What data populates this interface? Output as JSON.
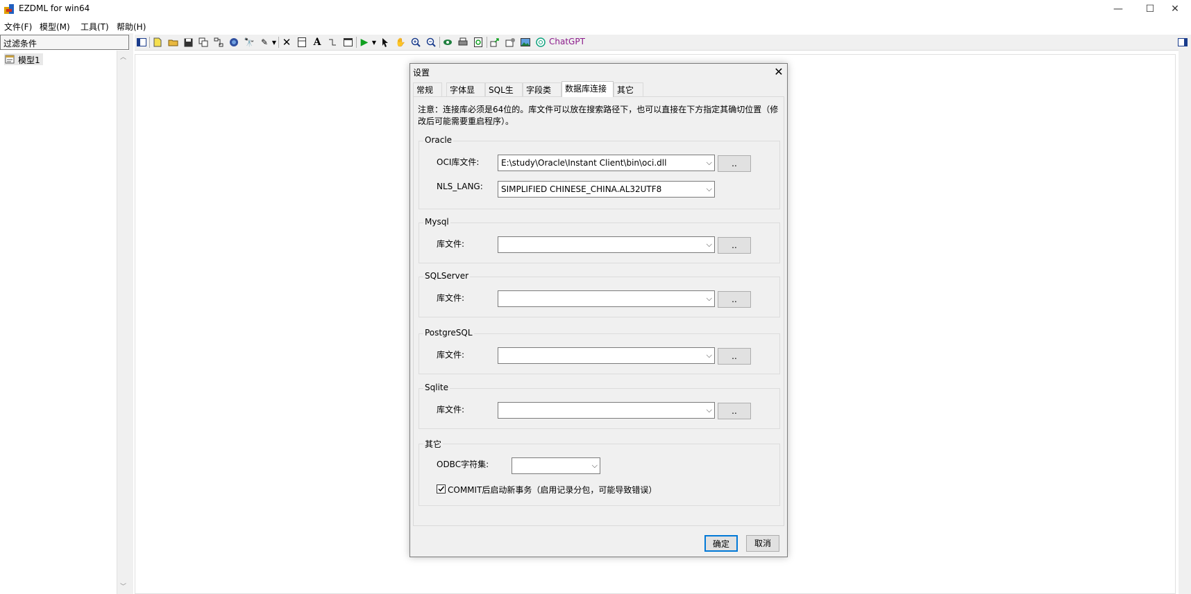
{
  "window": {
    "title": "EZDML for win64",
    "minimize_glyph": "—",
    "maximize_glyph": "☐",
    "close_glyph": "✕"
  },
  "menu": [
    "文件(F)",
    "模型(M)",
    "工具(T)",
    "帮助(H)"
  ],
  "left_panel": {
    "filter_label": "过滤条件",
    "tree_items": [
      {
        "label": "模型1",
        "icon": "model-icon"
      }
    ]
  },
  "toolbar": {
    "chatgpt_label": "ChatGPT",
    "icons": [
      "panel-toggle-icon",
      "new-file-icon",
      "open-folder-icon",
      "save-icon",
      "copy-icon",
      "table-icon",
      "find-icon",
      "brush-icon",
      "delete-icon",
      "box-icon",
      "text-icon",
      "link-icon",
      "window-icon",
      "run-icon",
      "pointer-icon",
      "hand-icon",
      "zoom-in-icon",
      "zoom-out-icon",
      "eye-icon",
      "print-icon",
      "refresh-icon",
      "export-icon",
      "settings-icon",
      "image-icon",
      "chatgpt-icon"
    ]
  },
  "dialog": {
    "title": "设置",
    "close_glyph": "✕",
    "tabs": [
      "常规",
      "字体显示",
      "SQL生成",
      "字段类型",
      "数据库连接",
      "其它"
    ],
    "active_tab": "数据库连接",
    "notice": "注意：连接库必须是64位的。库文件可以放在搜索路径下，也可以直接在下方指定其确切位置（修改后可能需要重启程序）。",
    "groups": {
      "oracle": {
        "legend": "Oracle",
        "oci_label": "OCI库文件:",
        "oci_value": "E:\\study\\Oracle\\Instant Client\\bin\\oci.dll",
        "nls_label": "NLS_LANG:",
        "nls_value": "SIMPLIFIED CHINESE_CHINA.AL32UTF8",
        "browse_label": ".."
      },
      "mysql": {
        "legend": "Mysql",
        "lib_label": "库文件:",
        "lib_value": "",
        "browse_label": ".."
      },
      "sqlserver": {
        "legend": "SQLServer",
        "lib_label": "库文件:",
        "lib_value": "",
        "browse_label": ".."
      },
      "postgresql": {
        "legend": "PostgreSQL",
        "lib_label": "库文件:",
        "lib_value": "",
        "browse_label": ".."
      },
      "sqlite": {
        "legend": "Sqlite",
        "lib_label": "库文件:",
        "lib_value": "",
        "browse_label": ".."
      },
      "other": {
        "legend": "其它",
        "odbc_label": "ODBC字符集:",
        "odbc_value": "",
        "commit_checked": true,
        "commit_label": "COMMIT后启动新事务（启用记录分包，可能导致错误）"
      }
    },
    "ok_label": "确定",
    "cancel_label": "取消"
  },
  "colors": {
    "accent": "#0078d7",
    "chatgpt_text": "#8b1a8b"
  }
}
